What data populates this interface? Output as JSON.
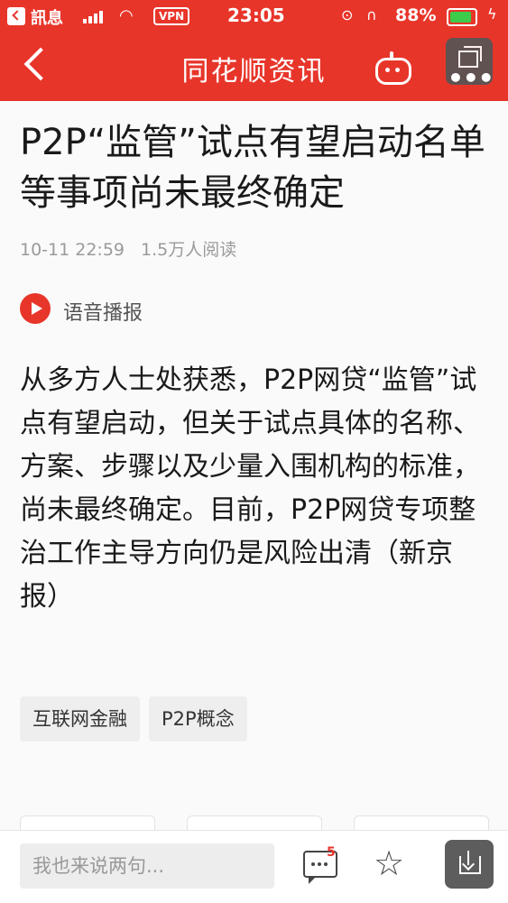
{
  "status_bar": {
    "carrier": "訊息",
    "vpn": "VPN",
    "time": "23:05",
    "battery_percent": "88%",
    "battery_level": 0.88
  },
  "nav": {
    "title": "同花顺资讯"
  },
  "article": {
    "title": "P2P“监管”试点有望启动名单等事项尚未最终确定",
    "date": "10-11 22:59",
    "reads": "1.5万人阅读",
    "voice_label": "语音播报",
    "body": "从多方人士处获悉，P2P网贷“监管”试点有望启动，但关于试点具体的名称、方案、步骤以及少量入围机构的标准，尚未最终确定。目前，P2P网贷专项整治工作主导方向仍是风险出清（新京报）"
  },
  "tags": [
    "互联网金融",
    "P2P概念"
  ],
  "bottom_bar": {
    "comment_placeholder": "我也来说两句...",
    "comment_count": "5"
  },
  "colors": {
    "brand_red": "#e8352a",
    "battery_green": "#3ccb4a"
  }
}
